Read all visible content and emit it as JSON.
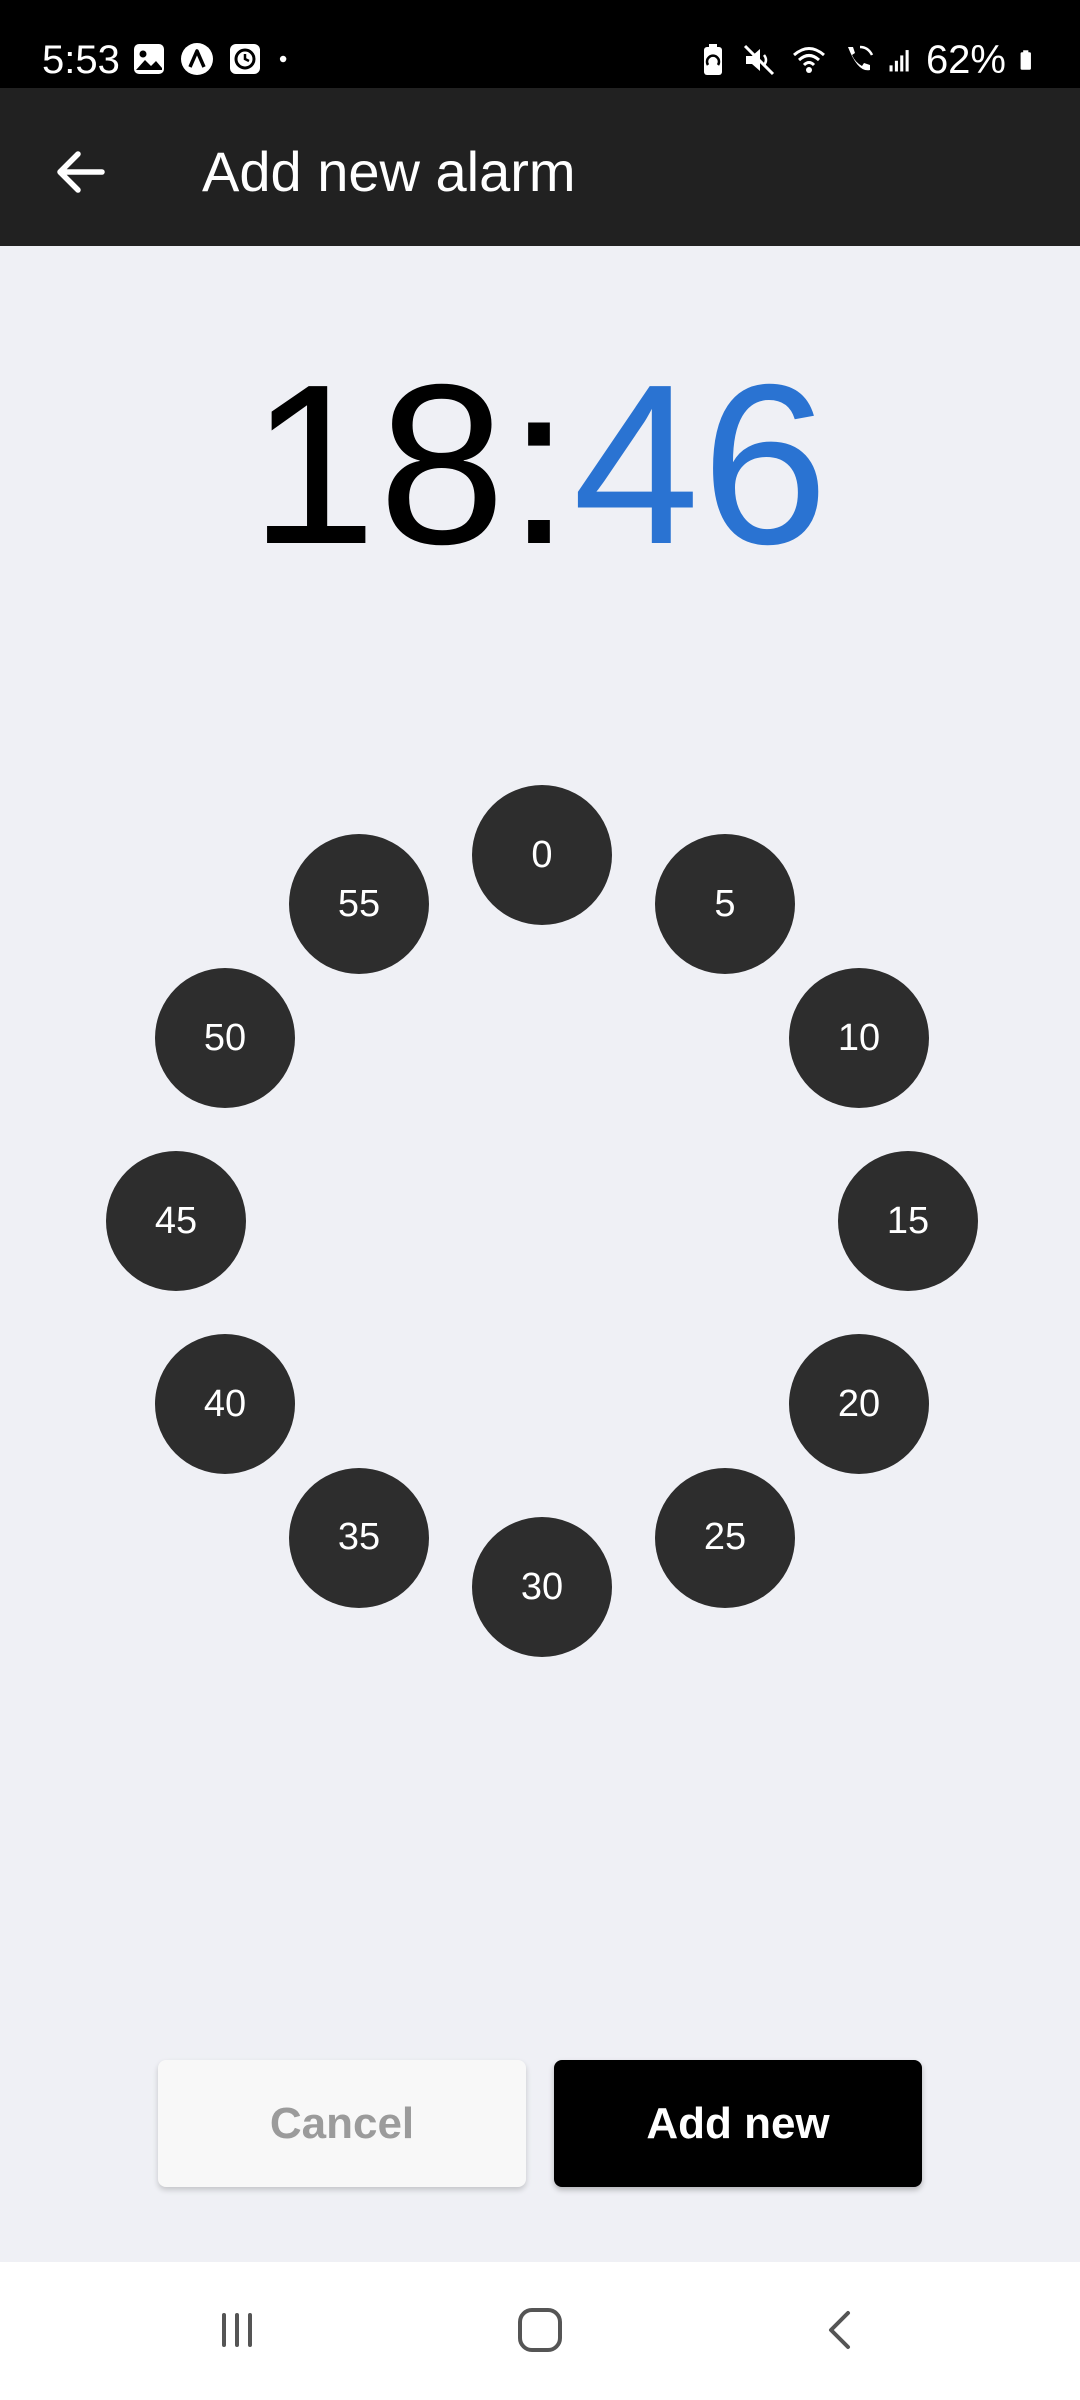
{
  "status_bar": {
    "time": "5:53",
    "battery": "62%",
    "left_icons": [
      "gallery-icon",
      "app-a-icon",
      "clock-icon",
      "dot-icon"
    ],
    "right_icons": [
      "battery-saver-icon",
      "mute-icon",
      "wifi-icon",
      "wifi-call-icon",
      "signal-icon",
      "battery-icon"
    ]
  },
  "app_bar": {
    "title": "Add new alarm",
    "back_icon": "arrow-left-icon"
  },
  "time": {
    "hour": "18",
    "separator": ":",
    "minute": "46"
  },
  "dial": {
    "labels": [
      "0",
      "5",
      "10",
      "15",
      "20",
      "25",
      "30",
      "35",
      "40",
      "45",
      "50",
      "55"
    ]
  },
  "actions": {
    "cancel_label": "Cancel",
    "add_label": "Add new"
  },
  "colors": {
    "minute_accent": "#2a73d2",
    "app_bar_bg": "#212121",
    "dial_item_bg": "#2d2d2d",
    "page_bg": "#eff0f5"
  }
}
